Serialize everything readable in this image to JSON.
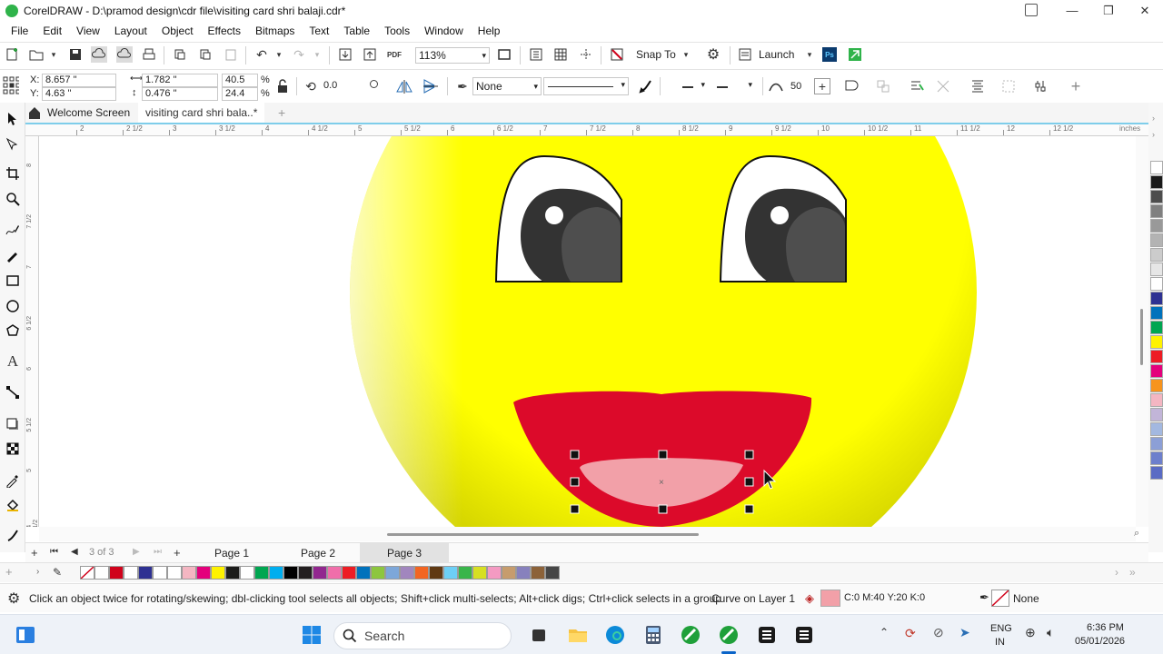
{
  "window": {
    "title": "CorelDRAW - D:\\pramod design\\cdr file\\visiting card shri balaji.cdr*",
    "minimize": "—",
    "maximize": "❐",
    "close": "✕"
  },
  "menu": [
    "File",
    "Edit",
    "View",
    "Layout",
    "Object",
    "Effects",
    "Bitmaps",
    "Text",
    "Table",
    "Tools",
    "Window",
    "Help"
  ],
  "standard_toolbar": {
    "zoom_value": "113%",
    "snap_to_label": "Snap To",
    "launch_label": "Launch"
  },
  "property_bar": {
    "x_label": "X:",
    "x_value": "8.657 \"",
    "y_label": "Y:",
    "y_value": "4.63 \"",
    "width_value": "1.782 \"",
    "height_value": "0.476 \"",
    "scale_w": "40.5",
    "scale_h": "24.4",
    "percent": "%",
    "rotation_value": "0.0",
    "outline_width": "None",
    "smoothing_value": "50"
  },
  "tabs": {
    "welcome": "Welcome Screen",
    "document": "visiting card shri bala..*",
    "add": "+"
  },
  "ruler": {
    "units": "inches",
    "h_labels": [
      "2",
      "2 1/2",
      "3",
      "3 1/2",
      "4",
      "4 1/2",
      "5",
      "5 1/2",
      "6",
      "6 1/2",
      "7",
      "7 1/2",
      "8",
      "8 1/2",
      "9",
      "9 1/2",
      "10",
      "10 1/2",
      "11",
      "11 1/2",
      "12",
      "12 1/2"
    ],
    "v_labels": [
      "8",
      "7 1/2",
      "7",
      "6 1/2",
      "6",
      "5 1/2",
      "5",
      "4 1/2"
    ]
  },
  "page_nav": {
    "counter": "3 of 3",
    "pages": [
      "Page 1",
      "Page 2",
      "Page 3"
    ],
    "active_page": "Page 3"
  },
  "palette_colors": [
    "#ffffff",
    "#d0021b",
    "#ffffff",
    "#2e3192",
    "#ffffff",
    "#ffffff",
    "#f4b6c2",
    "#e4007c",
    "#fff200",
    "#1d1d1b",
    "#ffffff",
    "#00a651",
    "#00aeef",
    "#000000",
    "#231f20",
    "#92278f",
    "#f06eaa",
    "#ed1c24",
    "#0072bc",
    "#8dc63f",
    "#7da7d9",
    "#a186be",
    "#f26522",
    "#603913",
    "#6dcff6",
    "#39b54a",
    "#d7df23",
    "#f49ac2",
    "#c69c6d",
    "#8781bd",
    "#8c6239",
    "#464646"
  ],
  "right_palette_colors": [
    "#ffffff",
    "#1a1a1a",
    "#4d4d4d",
    "#808080",
    "#999999",
    "#b3b3b3",
    "#cccccc",
    "#e6e6e6",
    "#ffffff",
    "#2e3192",
    "#0072bc",
    "#00a651",
    "#fff200",
    "#ed1c24",
    "#e4007c",
    "#f7941d",
    "#f4b6c2",
    "#c2b5d8",
    "#a3b8e0",
    "#8c9fd6",
    "#6d7fcc",
    "#5a6bc4"
  ],
  "status": {
    "hint": "Click an object twice for rotating/skewing; dbl-clicking tool selects all objects; Shift+click multi-selects; Alt+click digs; Ctrl+click selects in a group",
    "object_info": "Curve on Layer 1",
    "fill_color": "#f2a0a8",
    "fill_text": "C:0 M:40 Y:20 K:0",
    "outline_text": "None"
  },
  "taskbar": {
    "search_placeholder": "Search",
    "lang_top": "ENG",
    "lang_bottom": "IN",
    "time": "6:36 PM",
    "date": "05/01/2026"
  },
  "drawing": {
    "face_color": "#ffff00",
    "mouth_color": "#dc0a2a",
    "tongue_color": "#f2a0a8",
    "pupil_color": "#222222"
  }
}
